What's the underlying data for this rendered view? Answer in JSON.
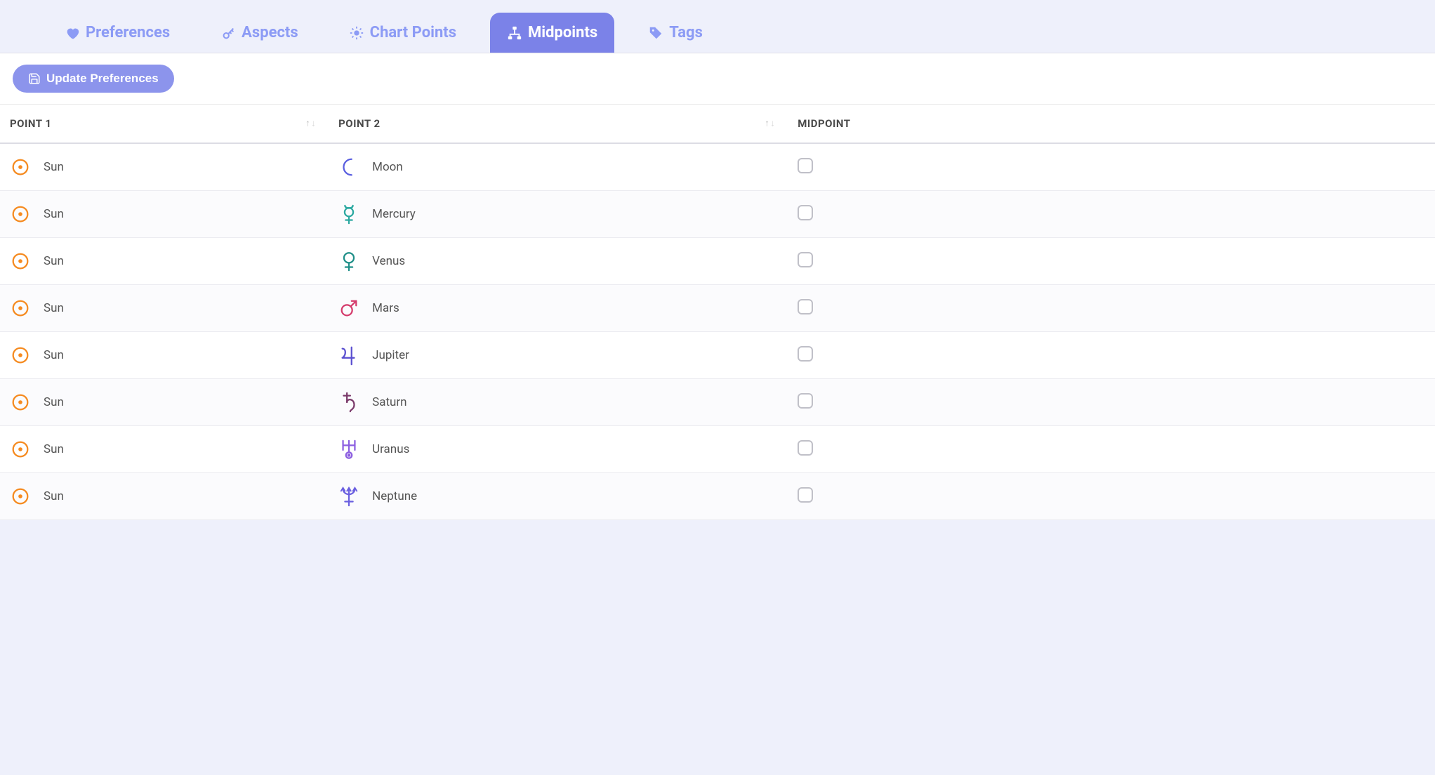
{
  "tabs": [
    {
      "label": "Preferences",
      "icon": "heart-icon",
      "active": false
    },
    {
      "label": "Aspects",
      "icon": "compass-icon",
      "active": false
    },
    {
      "label": "Chart Points",
      "icon": "gear-sun-icon",
      "active": false
    },
    {
      "label": "Midpoints",
      "icon": "sitemap-icon",
      "active": true
    },
    {
      "label": "Tags",
      "icon": "tags-icon",
      "active": false
    }
  ],
  "toolbar": {
    "update_label": "Update Preferences"
  },
  "columns": {
    "point1": "Point 1",
    "point2": "Point 2",
    "midpoint": "Midpoint"
  },
  "planet_colors": {
    "Sun": "#f58a1f",
    "Moon": "#5a5fe0",
    "Mercury": "#2aa8a0",
    "Venus": "#1f8f88",
    "Mars": "#d43a6b",
    "Jupiter": "#5a4fd0",
    "Saturn": "#7a3a6a",
    "Uranus": "#8c5fe0",
    "Neptune": "#6a5fe0"
  },
  "rows": [
    {
      "point1": "Sun",
      "point2": "Moon",
      "checked": false
    },
    {
      "point1": "Sun",
      "point2": "Mercury",
      "checked": false
    },
    {
      "point1": "Sun",
      "point2": "Venus",
      "checked": false
    },
    {
      "point1": "Sun",
      "point2": "Mars",
      "checked": false
    },
    {
      "point1": "Sun",
      "point2": "Jupiter",
      "checked": false
    },
    {
      "point1": "Sun",
      "point2": "Saturn",
      "checked": false
    },
    {
      "point1": "Sun",
      "point2": "Uranus",
      "checked": false
    },
    {
      "point1": "Sun",
      "point2": "Neptune",
      "checked": false
    }
  ]
}
